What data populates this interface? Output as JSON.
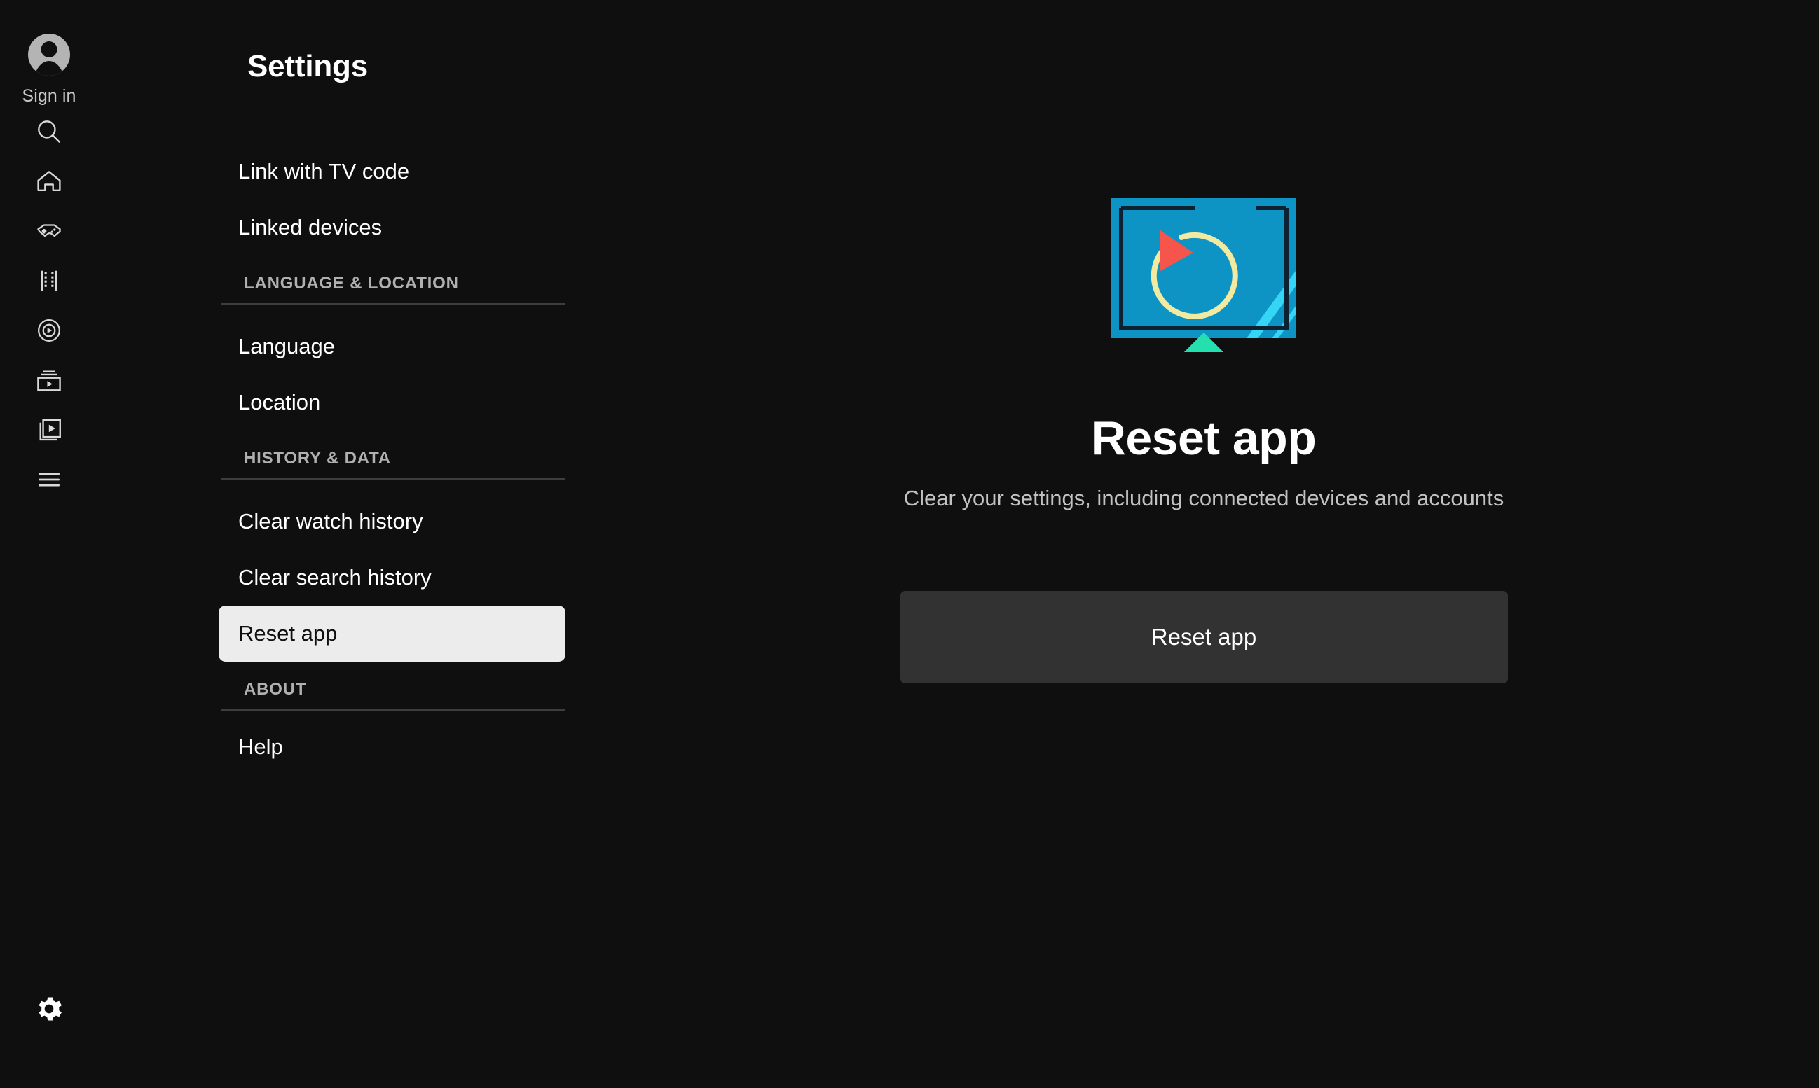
{
  "account": {
    "avatar_icon": "account-circle-icon",
    "sign_in_label": "Sign in"
  },
  "rail": {
    "items": [
      {
        "id": "search",
        "icon": "search-icon"
      },
      {
        "id": "home",
        "icon": "home-icon"
      },
      {
        "id": "gaming",
        "icon": "gamepad-icon"
      },
      {
        "id": "shorts",
        "icon": "film-strip-icon"
      },
      {
        "id": "live",
        "icon": "live-broadcast-icon"
      },
      {
        "id": "subscriptions",
        "icon": "subscriptions-icon"
      },
      {
        "id": "library",
        "icon": "library-icon"
      },
      {
        "id": "menu",
        "icon": "hamburger-menu-icon"
      }
    ],
    "settings": {
      "id": "settings",
      "icon": "gear-icon"
    }
  },
  "header": {
    "title": "Settings"
  },
  "settings_list": [
    {
      "type": "item",
      "label": "Link with TV code",
      "selected": false
    },
    {
      "type": "item",
      "label": "Linked devices",
      "selected": false
    },
    {
      "type": "section",
      "label": "LANGUAGE & LOCATION"
    },
    {
      "type": "item",
      "label": "Language",
      "selected": false
    },
    {
      "type": "item",
      "label": "Location",
      "selected": false
    },
    {
      "type": "section",
      "label": "HISTORY & DATA"
    },
    {
      "type": "item",
      "label": "Clear watch history",
      "selected": false
    },
    {
      "type": "item",
      "label": "Clear search history",
      "selected": false
    },
    {
      "type": "item",
      "label": "Reset app",
      "selected": true
    },
    {
      "type": "section",
      "label": "ABOUT"
    },
    {
      "type": "item",
      "label": "Help",
      "selected": false
    }
  ],
  "detail": {
    "illustration_icon": "tv-reset-illustration",
    "title": "Reset app",
    "subtitle": "Clear your settings, including connected devices and accounts",
    "button_label": "Reset app"
  },
  "colors": {
    "background": "#0f0f0f",
    "selected_item_bg": "#ececec",
    "selected_item_text": "#0f0f0f",
    "button_bg": "#323232",
    "divider": "#3a3a3a",
    "section_label": "#b0b0b0",
    "subtitle_text": "#c2c2c2",
    "illustration_screen_blue": "#0d94c4",
    "illustration_frame_navy": "#0c2233",
    "illustration_arrow_red": "#f5554b",
    "illustration_arc_yellow": "#f2eaa0",
    "illustration_stand_teal": "#24e0ae",
    "illustration_streak_cyan": "#35d6f5"
  }
}
